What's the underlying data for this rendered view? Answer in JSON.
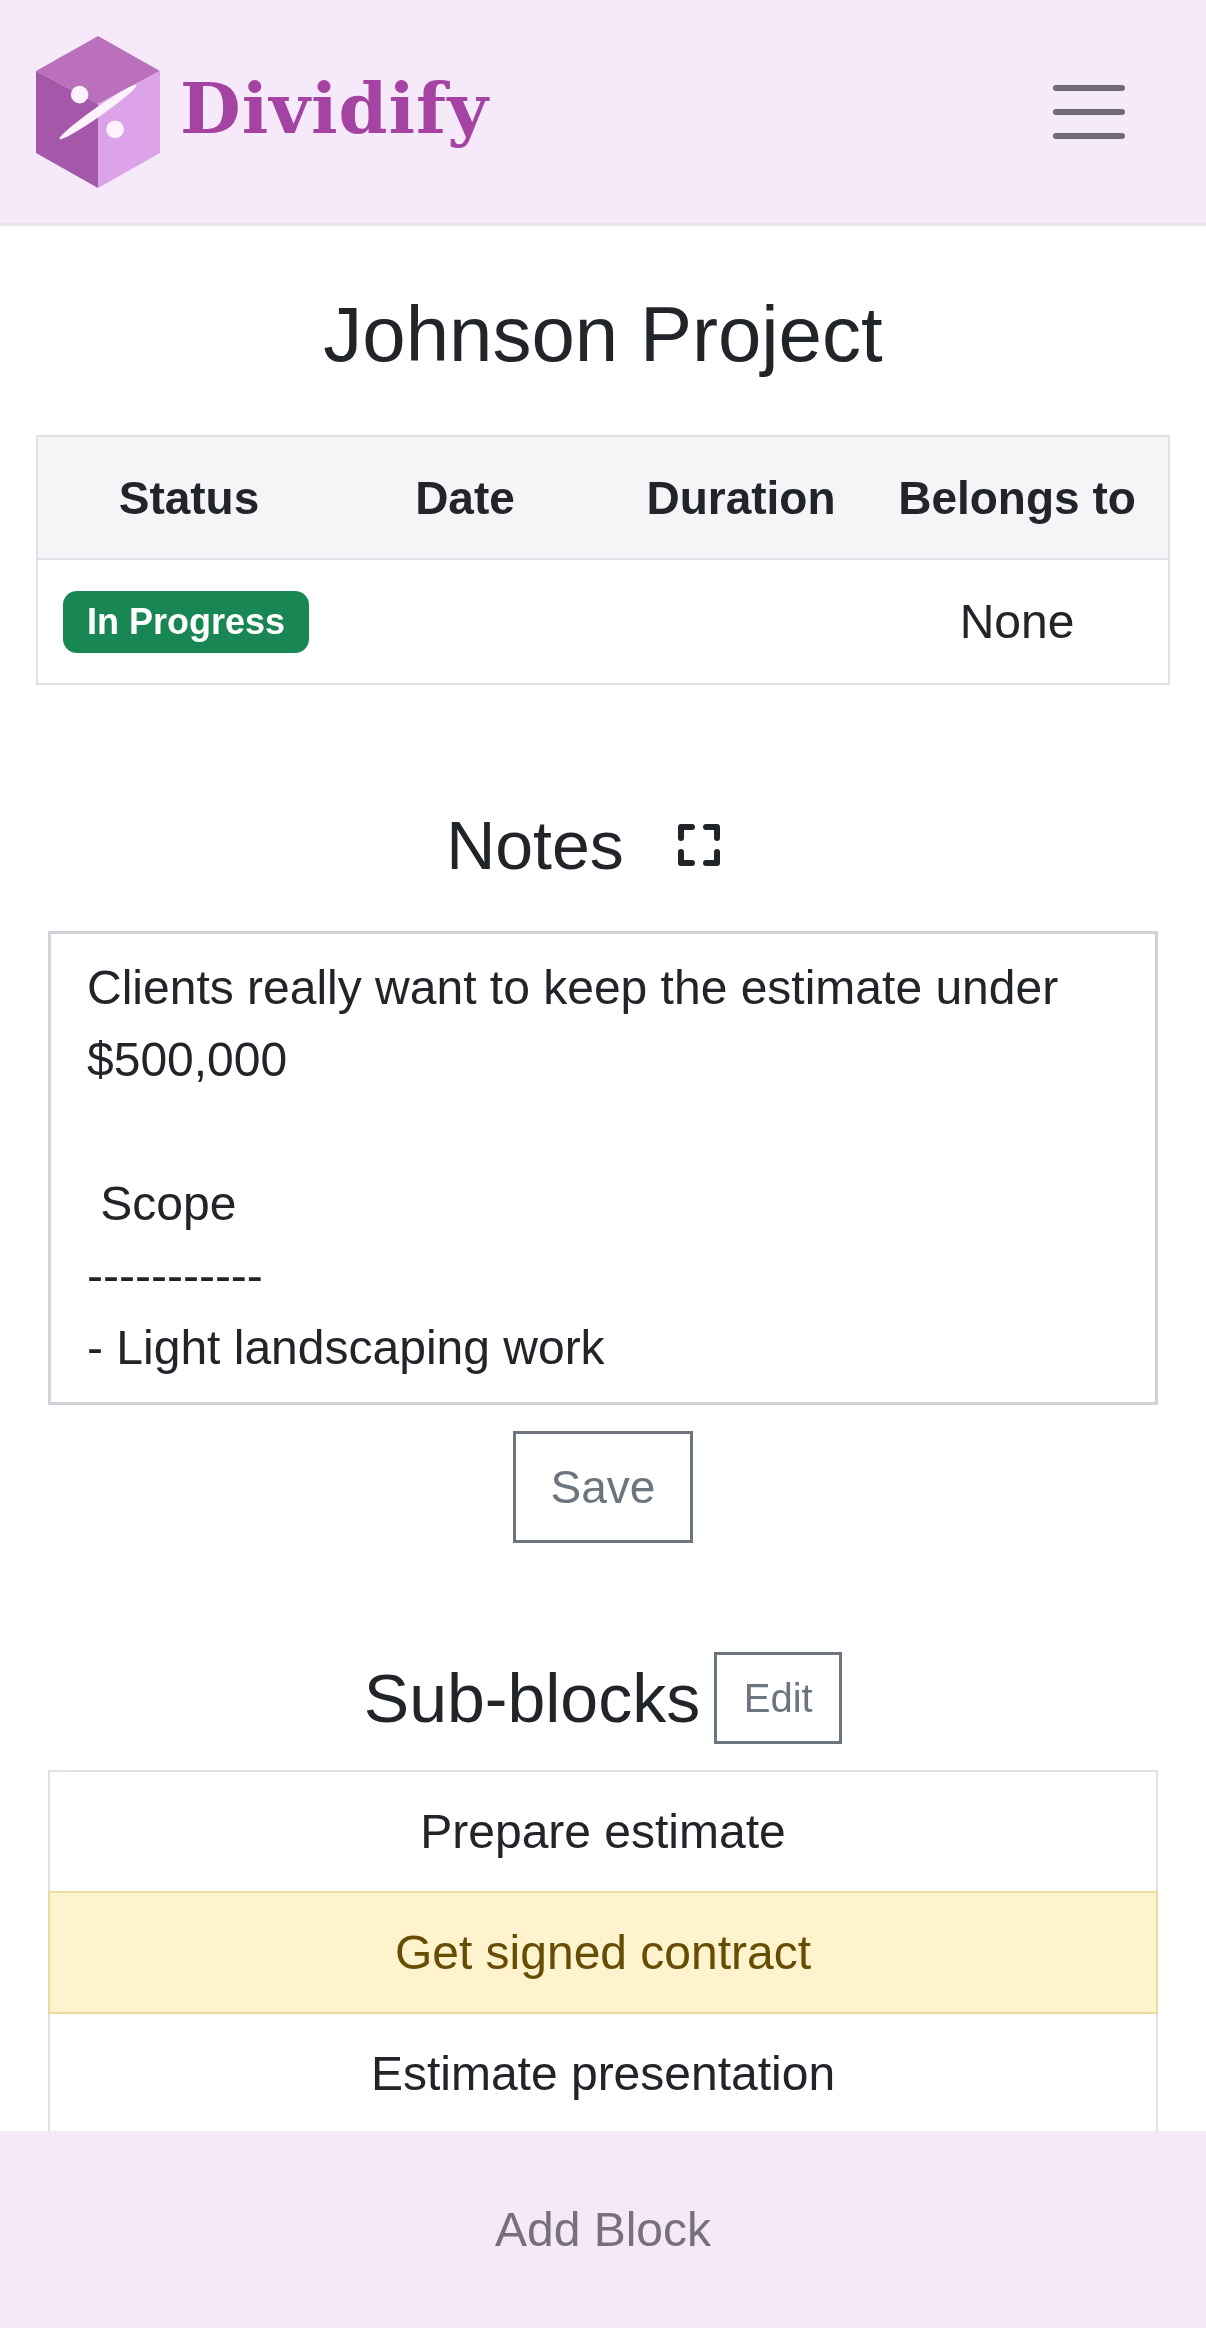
{
  "header": {
    "brand": "Dividify"
  },
  "project": {
    "title": "Johnson Project"
  },
  "table": {
    "columns": [
      "Status",
      "Date",
      "Duration",
      "Belongs to"
    ],
    "rows": [
      {
        "cells": [
          {
            "kind": "badge",
            "color": "#198754",
            "text": "In Progress"
          },
          {
            "kind": "blank"
          },
          {
            "kind": "blank"
          },
          {
            "kind": "text",
            "text": "None"
          }
        ]
      }
    ]
  },
  "notes": {
    "heading": "Notes",
    "value": "Clients really want to keep the estimate under $500,000\n\n Scope\n-----------\n- Light landscaping work",
    "save_button": "Save"
  },
  "sub_blocks": {
    "heading": "Sub-blocks",
    "edit_button": "Edit",
    "items": [
      {
        "label": "Prepare estimate",
        "selected": false
      },
      {
        "label": "Get signed contract",
        "selected": true
      },
      {
        "label": "Estimate presentation",
        "selected": false
      }
    ]
  },
  "footer": {
    "button": "Add Block"
  }
}
